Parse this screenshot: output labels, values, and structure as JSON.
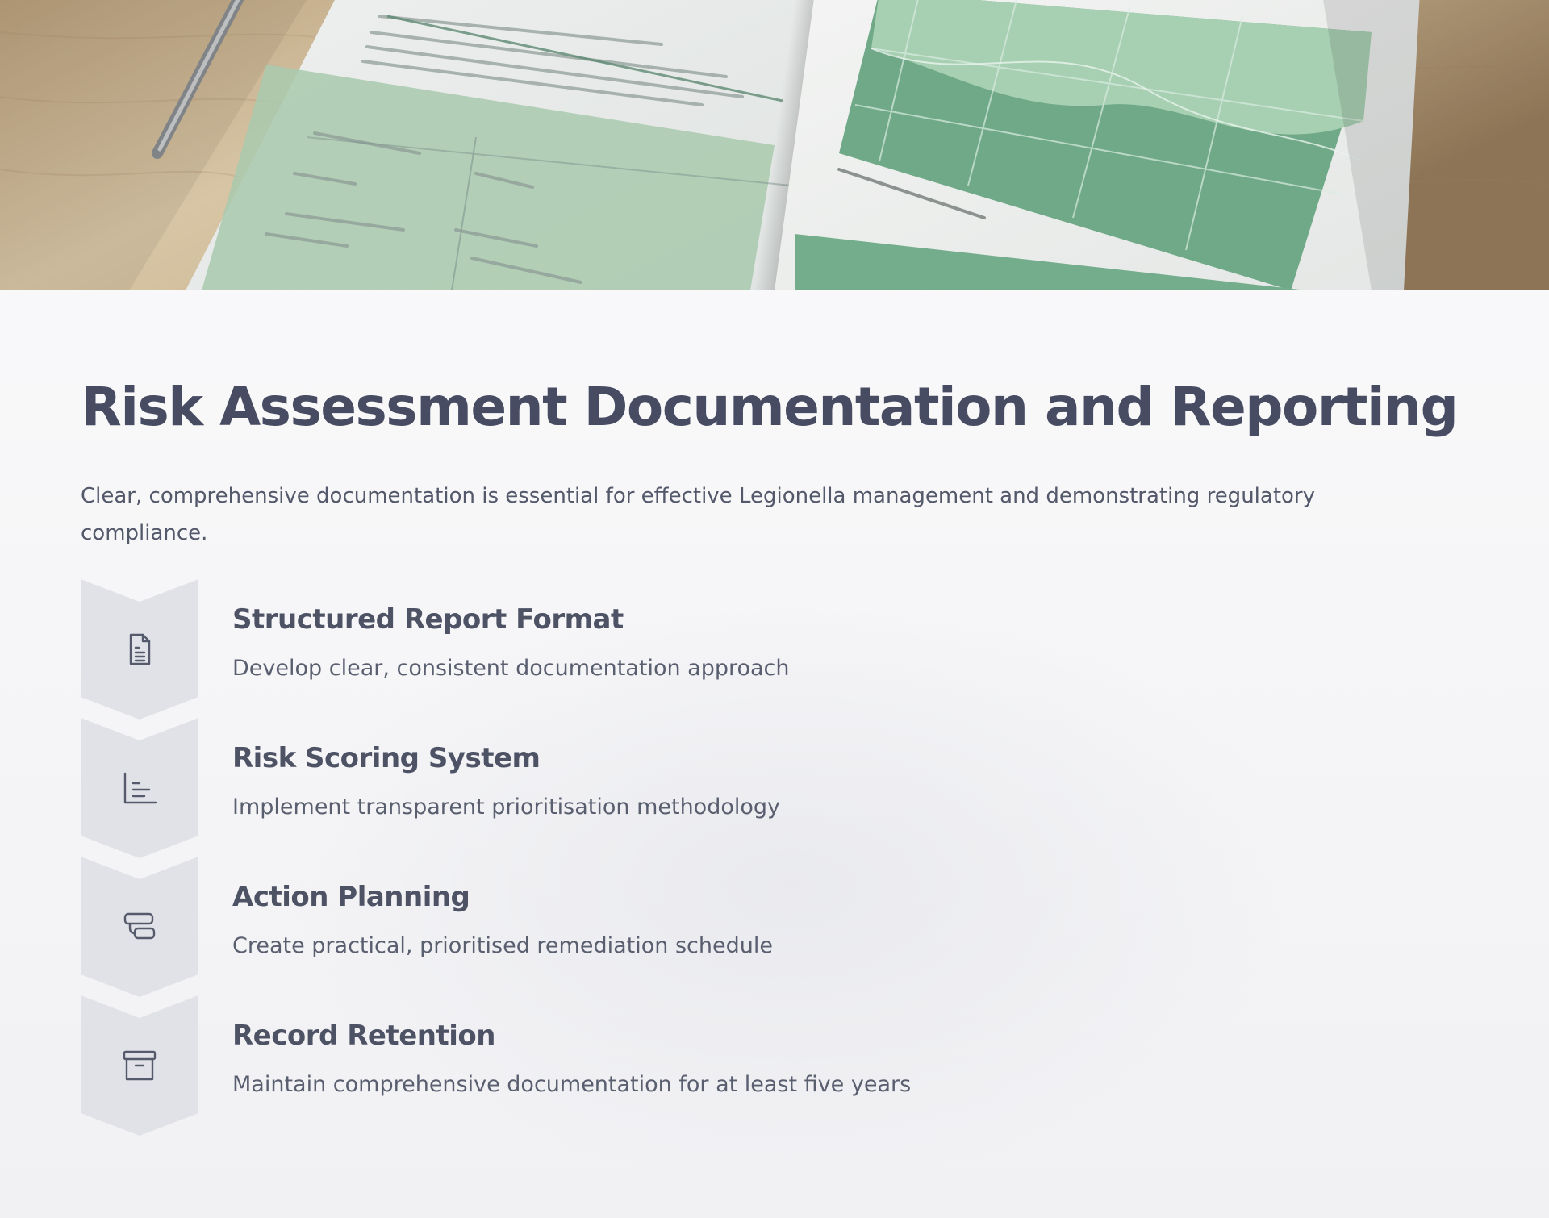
{
  "title": "Risk Assessment Documentation and Reporting",
  "intro": "Clear, comprehensive documentation is essential for effective Legionella management and demonstrating regulatory compliance.",
  "steps": [
    {
      "icon": "document-icon",
      "title": "Structured Report Format",
      "description": "Develop clear, consistent documentation approach"
    },
    {
      "icon": "bar-chart-icon",
      "title": "Risk Scoring System",
      "description": "Implement transparent prioritisation methodology"
    },
    {
      "icon": "action-plan-icon",
      "title": "Action Planning",
      "description": "Create practical, prioritised remediation schedule"
    },
    {
      "icon": "archive-icon",
      "title": "Record Retention",
      "description": "Maintain comprehensive documentation for at least five years"
    }
  ],
  "colors": {
    "title": "#474c62",
    "chevron_fill": "#e1e2e7",
    "icon_stroke": "#555a6c"
  }
}
